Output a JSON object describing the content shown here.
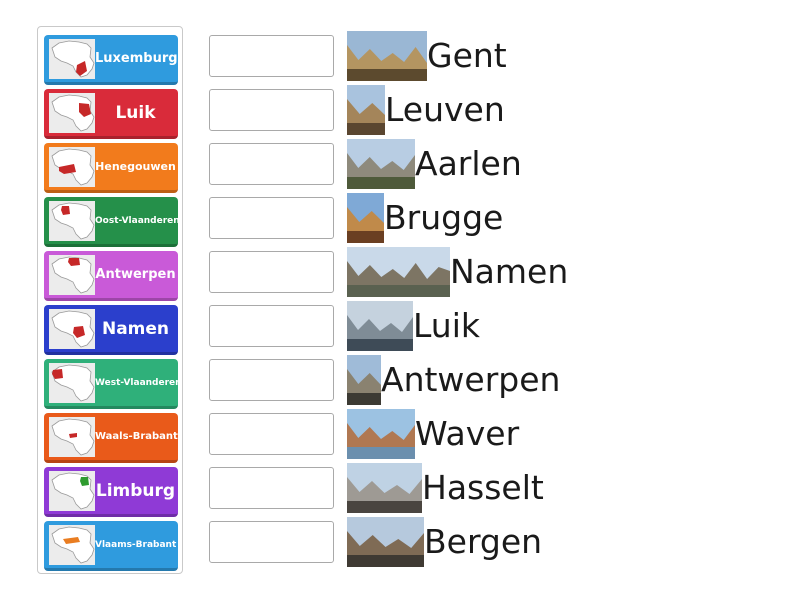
{
  "tiles": [
    {
      "label": "Luxemburg",
      "color": "#2f9bde",
      "highlight": "#c62828"
    },
    {
      "label": "Luik",
      "color": "#d92b3a",
      "highlight": "#c62828"
    },
    {
      "label": "Henegouwen",
      "color": "#f27b1c",
      "highlight": "#c62828"
    },
    {
      "label": "Oost-Vlaanderen",
      "color": "#25904a",
      "highlight": "#c62828"
    },
    {
      "label": "Antwerpen",
      "color": "#c95ad8",
      "highlight": "#c62828"
    },
    {
      "label": "Namen",
      "color": "#2b3fcc",
      "highlight": "#c62828"
    },
    {
      "label": "West-Vlaanderen",
      "color": "#2fb07a",
      "highlight": "#c62828"
    },
    {
      "label": "Waals-Brabant",
      "color": "#e95a1a",
      "highlight": "#c62828"
    },
    {
      "label": "Limburg",
      "color": "#8f3ad6",
      "highlight": "#2e9b2e"
    },
    {
      "label": "Vlaams-Brabant",
      "color": "#2f9bde",
      "highlight": "#e97d21"
    }
  ],
  "cities": [
    {
      "name": "Gent",
      "photo_icon": "gent-photo",
      "photo_w": 80
    },
    {
      "name": "Leuven",
      "photo_icon": "leuven-photo",
      "photo_w": 38
    },
    {
      "name": "Aarlen",
      "photo_icon": "aarlen-photo",
      "photo_w": 68
    },
    {
      "name": "Brugge",
      "photo_icon": "brugge-photo",
      "photo_w": 37
    },
    {
      "name": "Namen",
      "photo_icon": "namen-photo",
      "photo_w": 103
    },
    {
      "name": "Luik",
      "photo_icon": "luik-photo",
      "photo_w": 66
    },
    {
      "name": "Antwerpen",
      "photo_icon": "antwerpen-photo",
      "photo_w": 34
    },
    {
      "name": "Waver",
      "photo_icon": "waver-photo",
      "photo_w": 68
    },
    {
      "name": "Hasselt",
      "photo_icon": "hasselt-photo",
      "photo_w": 75
    },
    {
      "name": "Bergen",
      "photo_icon": "bergen-photo",
      "photo_w": 77
    }
  ]
}
